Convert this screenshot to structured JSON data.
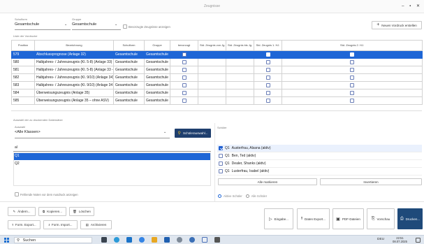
{
  "window": {
    "title": "Zeugnisse",
    "minimize": "–",
    "maximize": "▪",
    "close": "✕"
  },
  "filters": {
    "schulform_label": "Schulform",
    "schulform_value": "Gesamtschule",
    "gruppe_label": "Gruppe",
    "gruppe_value": "Gesamtschule",
    "bevorzugte_label": "Bevorzugte Zeugnisse anzeigen",
    "new_button": "Neuen Vordruck erstellen"
  },
  "table": {
    "section_label": "Liste der Vordrucke",
    "headers": [
      "Position",
      "Bezeichnung",
      "Schulform",
      "Gruppe",
      "bevorzugt",
      "Std. Zeugnis von Jg.",
      "Std. Zeugnis bis Jg.",
      "Std. Zeugnis 1. HJ.",
      "Std. Zeugnis 2. HJ."
    ],
    "rows": [
      {
        "pos": "579",
        "name": "Abschlussprognose (Anlage 32)",
        "schulform": "Gesamtschule",
        "gruppe": "Gesamtschule",
        "hj1": true,
        "selected": true
      },
      {
        "pos": "580",
        "name": "Halbjahres- / Jahreszeugnis (Kl. 5-8) (Anlage 33)",
        "schulform": "Gesamtschule",
        "gruppe": "Gesamtschule",
        "hj1": false,
        "selected": false
      },
      {
        "pos": "581",
        "name": "Halbjahres- / Jahreszeugnis (Kl. 5-8) (Anlage 33 - ohne ASV)",
        "schulform": "Gesamtschule",
        "gruppe": "Gesamtschule",
        "hj1": false,
        "selected": false
      },
      {
        "pos": "582",
        "name": "Halbjahres- / Jahreszeugnis (Kl. 9/10) (Anlage 34)",
        "schulform": "Gesamtschule",
        "gruppe": "Gesamtschule",
        "hj1": false,
        "selected": false
      },
      {
        "pos": "583",
        "name": "Halbjahres- / Jahreszeugnis (Kl. 9/10) (Anlage 34 - ohne ASV)",
        "schulform": "Gesamtschule",
        "gruppe": "Gesamtschule",
        "hj1": false,
        "selected": false
      },
      {
        "pos": "584",
        "name": "Überweisungszeugnis (Anlage 35)",
        "schulform": "Gesamtschule",
        "gruppe": "Gesamtschule",
        "hj1": false,
        "selected": false
      },
      {
        "pos": "585",
        "name": "Überweisungszeugnis (Anlage 35 – ohne ASV)",
        "schulform": "Gesamtschule",
        "gruppe": "Gesamtschule",
        "hj1": false,
        "selected": false
      }
    ]
  },
  "lower": {
    "section_label": "Auswahl der zu druckenden Datensätze",
    "auswahl_label": "Auswahl",
    "auswahl_value": "<Alle Klassen>",
    "schuelerauswahl_button": "Schülerauswahl...",
    "search_value": "al",
    "classes": [
      {
        "label": "Q1",
        "selected": true
      },
      {
        "label": "Q2",
        "selected": false
      }
    ],
    "schueler_label": "Schüler",
    "students": [
      {
        "klasse": "Q1",
        "name": "Austerfrau, Alsana (aktiv)",
        "checked": true,
        "highlight": true
      },
      {
        "klasse": "Q1",
        "name": "Ben, Ted (aktiv)",
        "checked": false,
        "highlight": false
      },
      {
        "klasse": "Q1",
        "name": "Dealer, Shanks (aktiv)",
        "checked": false,
        "highlight": false
      },
      {
        "klasse": "Q1",
        "name": "Lusterfrau, Isabel (aktiv)",
        "checked": false,
        "highlight": false
      }
    ],
    "alle_markieren": "Alle markieren",
    "invertieren": "Invertieren",
    "fehlende_noten": "Fehlende Noten vor dem Ausdruck anzeigen",
    "radio_aktive": "Aktive Schüler",
    "radio_alle": "Alle Schüler"
  },
  "actions": {
    "aendern": "Ändern...",
    "kopieren": "Kopieren...",
    "loeschen": "Löschen",
    "form_export": "Form. Export...",
    "form_import": "Form. Import...",
    "archivieren": "Archivieren",
    "eingabe": "Eingabe...",
    "daten_export": "Daten Export...",
    "pdf_dateien": "PDF-Dateien",
    "vorschau": "Vorschau",
    "drucken": "Drucken..."
  },
  "taskbar": {
    "search_placeholder": "Suchen",
    "tray_lang": "DEU",
    "time": "22:51",
    "date": "08.07.2025"
  },
  "colors": {
    "accent": "#1e66d6",
    "print_button": "#1f4a7a",
    "taskbar": "#dfe6ef"
  }
}
